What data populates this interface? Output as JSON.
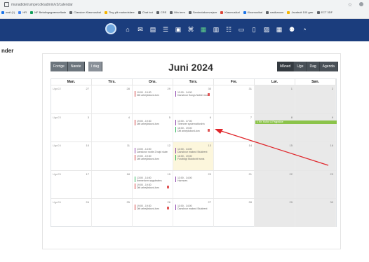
{
  "browser": {
    "url": "munadidetrumpet.dk/admin/v2/calendar",
    "bookmarks": [
      {
        "label": "mail (1)",
        "color": "#1a73e8"
      },
      {
        "label": "HR",
        "color": "#4285f4"
      },
      {
        "label": "NF Betalingsgrænseflade",
        "color": "#0f9d58"
      },
      {
        "label": "Classicm Klasmusikal",
        "color": "#5f6368"
      },
      {
        "label": "Ting på markedsføre",
        "color": "#f4b400"
      },
      {
        "label": "Chat bot",
        "color": "#5f6368"
      },
      {
        "label": "CRE",
        "color": "#5f6368"
      },
      {
        "label": "Min term",
        "color": "#5f6368"
      },
      {
        "label": "Senkrutakonvrejser",
        "color": "#5f6368"
      },
      {
        "label": "Klasmusikal",
        "color": "#db4437"
      },
      {
        "label": "Klasmusikal",
        "color": "#1a73e8"
      },
      {
        "label": "nasikanom",
        "color": "#5f6368"
      },
      {
        "label": "Javafruit 100 gær",
        "color": "#f4b400"
      },
      {
        "label": "ECT 3DF",
        "color": "#5f6368"
      }
    ]
  },
  "nav": {
    "icons": [
      "home-icon",
      "mail-icon",
      "document-icon",
      "list-icon",
      "box-icon",
      "building-icon",
      "calendar-icon",
      "table-icon",
      "chat-icon",
      "monitor-icon",
      "phone-icon",
      "image-icon",
      "grid-icon",
      "users-icon",
      "clock-icon"
    ],
    "icon_glyphs": [
      "⌂",
      "✉",
      "▤",
      "☰",
      "▣",
      "⌘",
      "▦",
      "▥",
      "☷",
      "▭",
      "▯",
      "▨",
      "▦",
      "⚉",
      "◔"
    ],
    "active_index": 6
  },
  "page": {
    "title": "nder"
  },
  "toolbar": {
    "prev": "Forrige",
    "next": "Næste",
    "today": "I dag",
    "month_title": "Juni 2024",
    "views": [
      "Måned",
      "Uge",
      "Dag",
      "Agenda"
    ],
    "active_view": 0
  },
  "calendar": {
    "day_headers": [
      "Man.",
      "Tirs.",
      "Ons.",
      "Tors.",
      "Fre.",
      "Lør.",
      "Søn."
    ],
    "weeks": [
      {
        "label": "Uge22",
        "days": [
          "27",
          "28",
          "29",
          "30",
          "31",
          "1",
          "2"
        ],
        "events": [
          {
            "day": 2,
            "slot": 0,
            "time": "19:00 - 19:30",
            "text": "Ditt arbejdsbord-tom",
            "color": "red"
          },
          {
            "day": 3,
            "slot": 0,
            "time": "13:00 - 14:00",
            "text": "Dansknor Songs Noble mod",
            "color": "purple",
            "trash": true
          }
        ]
      },
      {
        "label": "Uge23",
        "days": [
          "3",
          "4",
          "5",
          "6",
          "7",
          "8",
          "9"
        ],
        "allday": {
          "start": 5,
          "end": 6,
          "text": "1 Kir. Kultur & Fagpakke"
        },
        "events": [
          {
            "day": 2,
            "slot": 0,
            "time": "19:00 - 19:30",
            "text": "Ditt arbejdsbord-tom",
            "color": "red"
          },
          {
            "day": 3,
            "slot": 0,
            "time": "13:00 - 17:00",
            "text": "Tilrenner systemutfordrin",
            "color": "purple"
          },
          {
            "day": 3,
            "slot": 1,
            "time": "16:00 - 19:00",
            "text": "Ditt arbejdsbord-tom",
            "color": "green",
            "trash": true
          }
        ]
      },
      {
        "label": "Uge24",
        "days": [
          "10",
          "11",
          "12",
          "13",
          "14",
          "15",
          "16"
        ],
        "events": [
          {
            "day": 2,
            "slot": 0,
            "time": "13:00 - 14:00",
            "text": "Dansknor noble 2 bøjd sluter",
            "color": "purple"
          },
          {
            "day": 2,
            "slot": 1,
            "time": "19:00 - 19:30",
            "text": "Ditt arbejdsbord-tom",
            "color": "red"
          },
          {
            "day": 3,
            "slot": 0,
            "time": "13:00 - 14:00",
            "text": "Dansknor makeol Stutdrent",
            "color": "purple"
          },
          {
            "day": 3,
            "slot": 1,
            "time": "16:00 - 19:00",
            "text": "Forafdigt Stutdrcbt tronis",
            "color": "green"
          }
        ]
      },
      {
        "label": "Uge25",
        "days": [
          "17",
          "18",
          "19",
          "20",
          "21",
          "22",
          "23"
        ],
        "events": [
          {
            "day": 2,
            "slot": 0,
            "time": "13:00 - 14:00",
            "text": "Ibemefonm sagsteders",
            "color": "green"
          },
          {
            "day": 2,
            "slot": 1,
            "time": "19:00 - 19:30",
            "text": "Ditt arbejdsbord-tom",
            "color": "red",
            "trash": true
          },
          {
            "day": 3,
            "slot": 0,
            "time": "13:00 - 14:00",
            "text": "Harmoes",
            "color": "purple"
          }
        ]
      },
      {
        "label": "Uge26",
        "days": [
          "24",
          "25",
          "26",
          "27",
          "28",
          "29",
          "30"
        ],
        "events": [
          {
            "day": 2,
            "slot": 0,
            "time": "19:00 - 19:30",
            "text": "Ditt arbejdsbord-tom",
            "color": "red",
            "trash": true
          },
          {
            "day": 3,
            "slot": 0,
            "time": "13:00 - 14:00",
            "text": "Dansknor makeol Stutdrent",
            "color": "purple"
          }
        ]
      }
    ]
  },
  "colors": {
    "appbar": "#1b3d7d",
    "annotation_arrow": "#e0262b",
    "allday": "#8bc34a"
  }
}
